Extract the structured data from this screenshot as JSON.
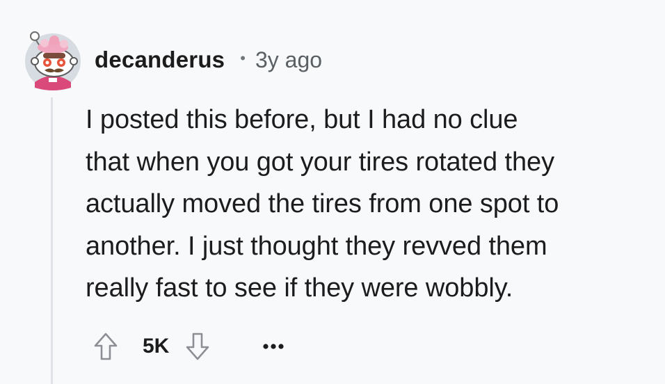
{
  "comment": {
    "username": "decanderus",
    "separator": "•",
    "timestamp": "3y ago",
    "body": "I posted this before, but I had no clue\nthat when you got your tires rotated they\nactually moved the tires from one spot to\nanother. I just thought they revved them\nreally fast to see if they were wobbly.",
    "score": "5K"
  },
  "icons": {
    "avatar": "snoo-avatar-icon",
    "upvote": "arrow-up-icon",
    "downvote": "arrow-down-icon",
    "more": "more-options-icon"
  },
  "colors": {
    "background": "#f8f9fb",
    "text": "#1c1c1c",
    "muted": "#5a5f63",
    "thread_line": "#dfe3e8",
    "icon_stroke": "#8b8f94"
  }
}
